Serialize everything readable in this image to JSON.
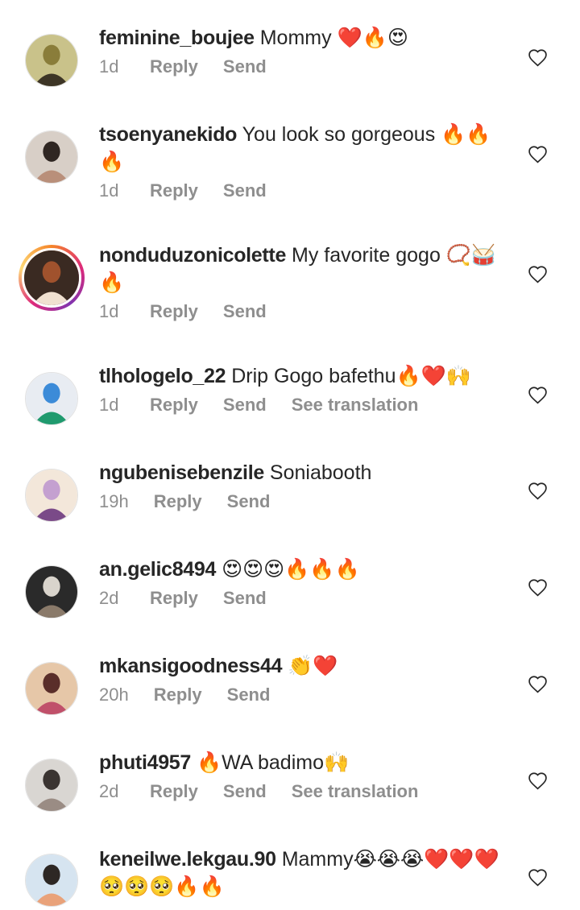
{
  "ui": {
    "reply": "Reply",
    "send": "Send",
    "see_translation": "See translation"
  },
  "comments": [
    {
      "user": "feminine_boujee",
      "text": "Mommy ❤️🔥😍",
      "time": "1d",
      "translation": false,
      "story": false
    },
    {
      "user": "tsoenyanekido",
      "text": "You look so gorgeous 🔥🔥 🔥",
      "time": "1d",
      "translation": false,
      "story": false
    },
    {
      "user": "nonduduzonicolette",
      "text": "My favorite gogo 📿🥁 🔥",
      "time": "1d",
      "translation": false,
      "story": true
    },
    {
      "user": "tlhologelo_22",
      "text": "Drip Gogo bafethu🔥❤️🙌",
      "time": "1d",
      "translation": true,
      "story": false
    },
    {
      "user": "ngubenisebenzile",
      "text": "Soniabooth",
      "time": "19h",
      "translation": false,
      "story": false
    },
    {
      "user": "an.gelic8494",
      "text": "😍😍😍🔥🔥🔥",
      "time": "2d",
      "translation": false,
      "story": false
    },
    {
      "user": "mkansigoodness44",
      "text": "👏❤️",
      "time": "20h",
      "translation": false,
      "story": false
    },
    {
      "user": "phuti4957",
      "text": "🔥WA badimo🙌",
      "time": "2d",
      "translation": true,
      "story": false
    },
    {
      "user": "keneilwe.lekgau.90",
      "text": "Mammy😭😭😭❤️❤️❤️ 🥺🥺🥺🔥🔥",
      "time": "",
      "translation": false,
      "story": false
    }
  ]
}
